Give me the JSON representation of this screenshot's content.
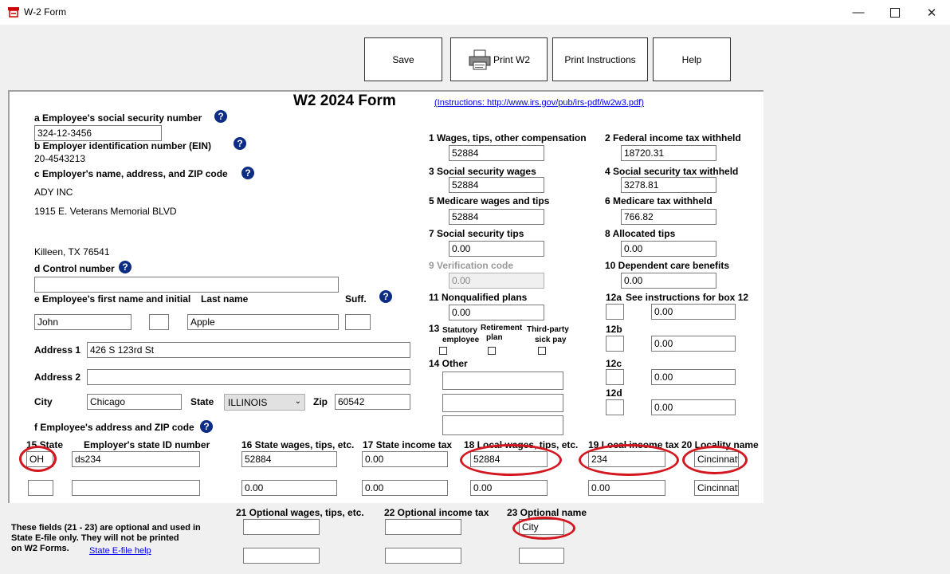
{
  "window": {
    "title": "W-2 Form"
  },
  "toolbar": {
    "save": "Save",
    "print_w2": "Print W2",
    "print_instructions": "Print Instructions",
    "help": "Help"
  },
  "form": {
    "title": "W2 2024 Form",
    "instructions_link": "(Instructions: http://www.irs.gov/pub/irs-pdf/iw2w3.pdf)",
    "help_glyph": "?",
    "a_label": "a Employee's social security number",
    "a_value": "324-12-3456",
    "b_label": "b Employer identification number (EIN)",
    "b_value": "20-4543213",
    "c_label": "c Employer's name, address, and ZIP code",
    "c_name": "ADY INC",
    "c_address": "1915 E. Veterans Memorial BLVD",
    "c_citystate": "Killeen, TX 76541",
    "d_label": "d Control number",
    "d_value": "",
    "e_label": "e Employee's first name and initial",
    "e_last_label": "Last name",
    "e_suff_label": "Suff.",
    "e_first": "John",
    "e_initial": "",
    "e_last": "Apple",
    "e_suff": "",
    "addr1_label": "Address 1",
    "addr1_value": "426 S 123rd St",
    "addr2_label": "Address 2",
    "addr2_value": "",
    "city_label": "City",
    "city_value": "Chicago",
    "state_label": "State",
    "state_value": "ILLINOIS",
    "zip_label": "Zip",
    "zip_value": "60542",
    "f_label": "f Employee's address and ZIP code",
    "b1_label": "1 Wages, tips, other compensation",
    "b1": "52884",
    "b2_label": "2 Federal income tax withheld",
    "b2": "18720.31",
    "b3_label": "3 Social security wages",
    "b3": "52884",
    "b4_label": "4 Social security tax withheld",
    "b4": "3278.81",
    "b5_label": "5 Medicare wages and tips",
    "b5": "52884",
    "b6_label": "6 Medicare tax withheld",
    "b6": "766.82",
    "b7_label": "7 Social security tips",
    "b7": "0.00",
    "b8_label": "8 Allocated tips",
    "b8": "0.00",
    "b9_label": "9 Verification code",
    "b9": "0.00",
    "b10_label": "10 Dependent care benefits",
    "b10": "0.00",
    "b11_label": "11 Nonqualified plans",
    "b11": "0.00",
    "b12a_label": "12a",
    "b12_instr": "See instructions for box 12",
    "b12a_code": "",
    "b12a": "0.00",
    "b12b_label": "12b",
    "b12b_code": "",
    "b12b": "0.00",
    "b12c_label": "12c",
    "b12c_code": "",
    "b12c": "0.00",
    "b12d_label": "12d",
    "b12d_code": "",
    "b12d": "0.00",
    "b13_label": "13",
    "b13_statutory": "Statutory",
    "b13_employee": "employee",
    "b13_retirement": "Retirement",
    "b13_plan": "plan",
    "b13_thirdparty": "Third-party",
    "b13_sickpay": "sick pay",
    "b14_label": "14 Other",
    "b15_label": "15 State",
    "b15_id_label": "Employer's state ID number",
    "b16_label": "16 State wages, tips, etc.",
    "b17_label": "17 State income tax",
    "b18_label": "18 Local wages, tips, etc.",
    "b19_label": "19 Local income tax",
    "b20_label": "20 Locality name",
    "row1": {
      "state": "OH",
      "state_id": "ds234",
      "b16": "52884",
      "b17": "0.00",
      "b18": "52884",
      "b19": "234",
      "b20": "Cincinnatti"
    },
    "row2": {
      "state": "",
      "state_id": "",
      "b16": "0.00",
      "b17": "0.00",
      "b18": "0.00",
      "b19": "0.00",
      "b20": "Cincinnatti"
    }
  },
  "optional": {
    "b21_label": "21 Optional wages, tips, etc.",
    "b22_label": "22 Optional income tax",
    "b23_label": "23 Optional name",
    "b23_value": "City",
    "note_line1": "These fields (21 - 23) are optional and used in",
    "note_line2": "State E-file only.  They will not be printed",
    "note_line3": "on W2 Forms.",
    "efile_help": "State E-file help"
  }
}
